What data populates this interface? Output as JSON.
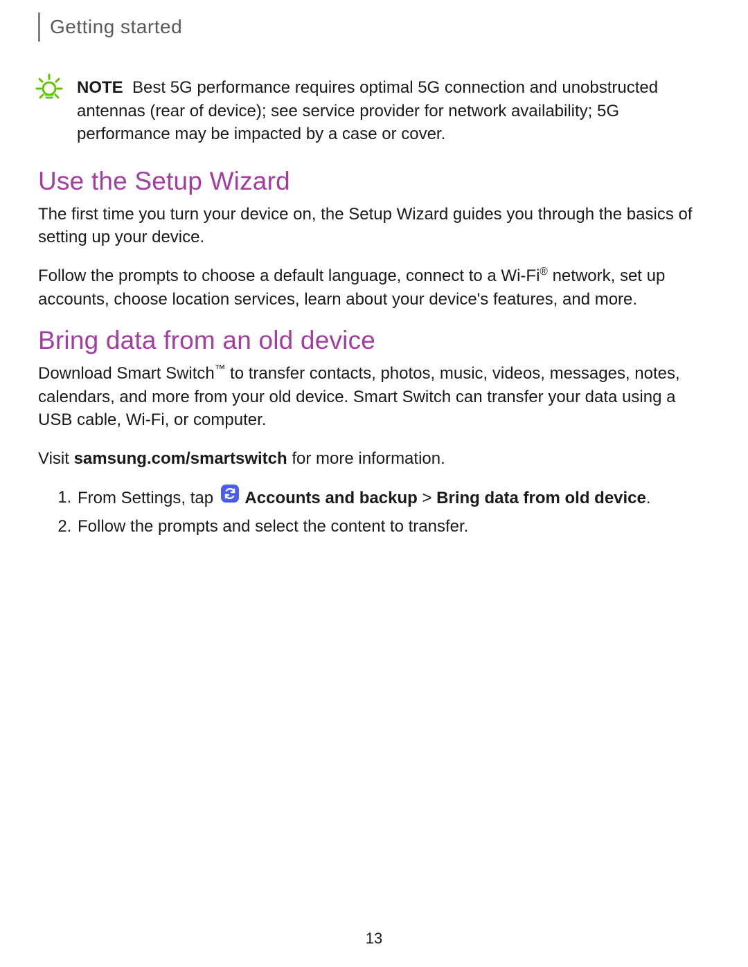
{
  "header": {
    "section_title": "Getting started"
  },
  "note": {
    "label": "NOTE",
    "text": "Best 5G performance requires optimal 5G connection and unobstructed antennas (rear of device); see service provider for network availability; 5G performance may be impacted by a case or cover."
  },
  "section1": {
    "heading": "Use the Setup Wizard",
    "p1": "The first time you turn your device on, the Setup Wizard guides you through the basics of setting up your device.",
    "p2_pre": "Follow the prompts to choose a default language, connect to a Wi-Fi",
    "p2_sup": "®",
    "p2_post": " network, set up accounts, choose location services, learn about your device's features, and more."
  },
  "section2": {
    "heading": "Bring data from an old device",
    "p1_pre": "Download Smart Switch",
    "p1_sup": "™",
    "p1_post": " to transfer contacts, photos, music, videos, messages, notes, calendars, and more from your old device. Smart Switch can transfer your data using a USB cable, Wi-Fi, or computer.",
    "visit_pre": "Visit ",
    "visit_link": "samsung.com/smartswitch",
    "visit_post": " for more information.",
    "steps": {
      "s1_pre": "From Settings, tap ",
      "s1_bold1": "Accounts and backup",
      "s1_mid": " > ",
      "s1_bold2": "Bring data from old device",
      "s1_end": ".",
      "s2": "Follow the prompts and select the content to transfer."
    }
  },
  "page_number": "13",
  "colors": {
    "accent": "#a23ea0",
    "note_icon": "#62c400",
    "inline_icon_bg": "#4c5ef2"
  }
}
